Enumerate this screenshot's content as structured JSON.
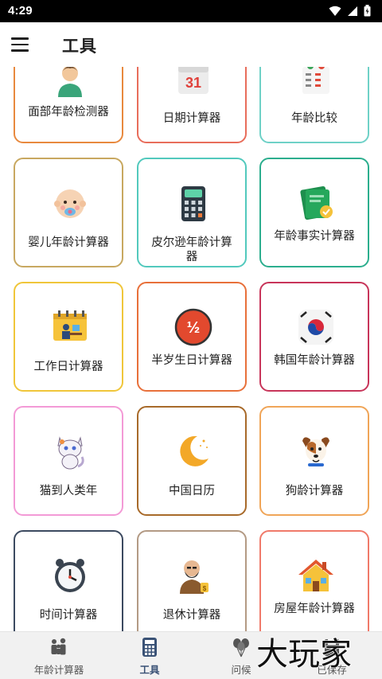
{
  "status_bar": {
    "time": "4:29"
  },
  "app_bar": {
    "title": "工具"
  },
  "tools": [
    {
      "label": "面部年龄检测器",
      "border": "#e8893e",
      "icon": "face-age-icon"
    },
    {
      "label": "日期计算器",
      "border": "#e86d5b",
      "icon": "calendar-icon"
    },
    {
      "label": "年龄比较",
      "border": "#6fd1c7",
      "icon": "compare-icon"
    },
    {
      "label": "婴儿年龄计算器",
      "border": "#c8a860",
      "icon": "baby-icon"
    },
    {
      "label": "皮尔逊年龄计算器",
      "border": "#52c9bd",
      "icon": "calculator-icon"
    },
    {
      "label": "年龄事实计算器",
      "border": "#2cae8e",
      "icon": "certificate-icon"
    },
    {
      "label": "工作日计算器",
      "border": "#f0c63a",
      "icon": "workday-icon"
    },
    {
      "label": "半岁生日计算器",
      "border": "#e8703a",
      "icon": "half-birthday-icon"
    },
    {
      "label": "韩国年龄计算器",
      "border": "#c8355a",
      "icon": "korea-flag-icon"
    },
    {
      "label": "猫到人类年",
      "border": "#f39ad6",
      "icon": "cat-icon"
    },
    {
      "label": "中国日历",
      "border": "#a86a2a",
      "icon": "moon-icon"
    },
    {
      "label": "狗龄计算器",
      "border": "#f0a558",
      "icon": "dog-icon"
    },
    {
      "label": "时间计算器",
      "border": "#3c4a60",
      "icon": "clock-icon"
    },
    {
      "label": "退休计算器",
      "border": "#b39a84",
      "icon": "retirement-icon"
    },
    {
      "label": "房屋年龄计算器",
      "border": "#f07a6a",
      "icon": "house-icon"
    }
  ],
  "bottom_nav": [
    {
      "label": "年龄计算器",
      "icon": "family-icon",
      "active": false
    },
    {
      "label": "工具",
      "icon": "calculator-icon",
      "active": true
    },
    {
      "label": "问候",
      "icon": "balloons-icon",
      "active": false
    },
    {
      "label": "已保存",
      "icon": "saved-icon",
      "active": false
    }
  ],
  "watermark": {
    "text": "大玩家"
  },
  "colors": {
    "active_nav": "#3a5276",
    "nav_bg": "#f1f1f1"
  }
}
